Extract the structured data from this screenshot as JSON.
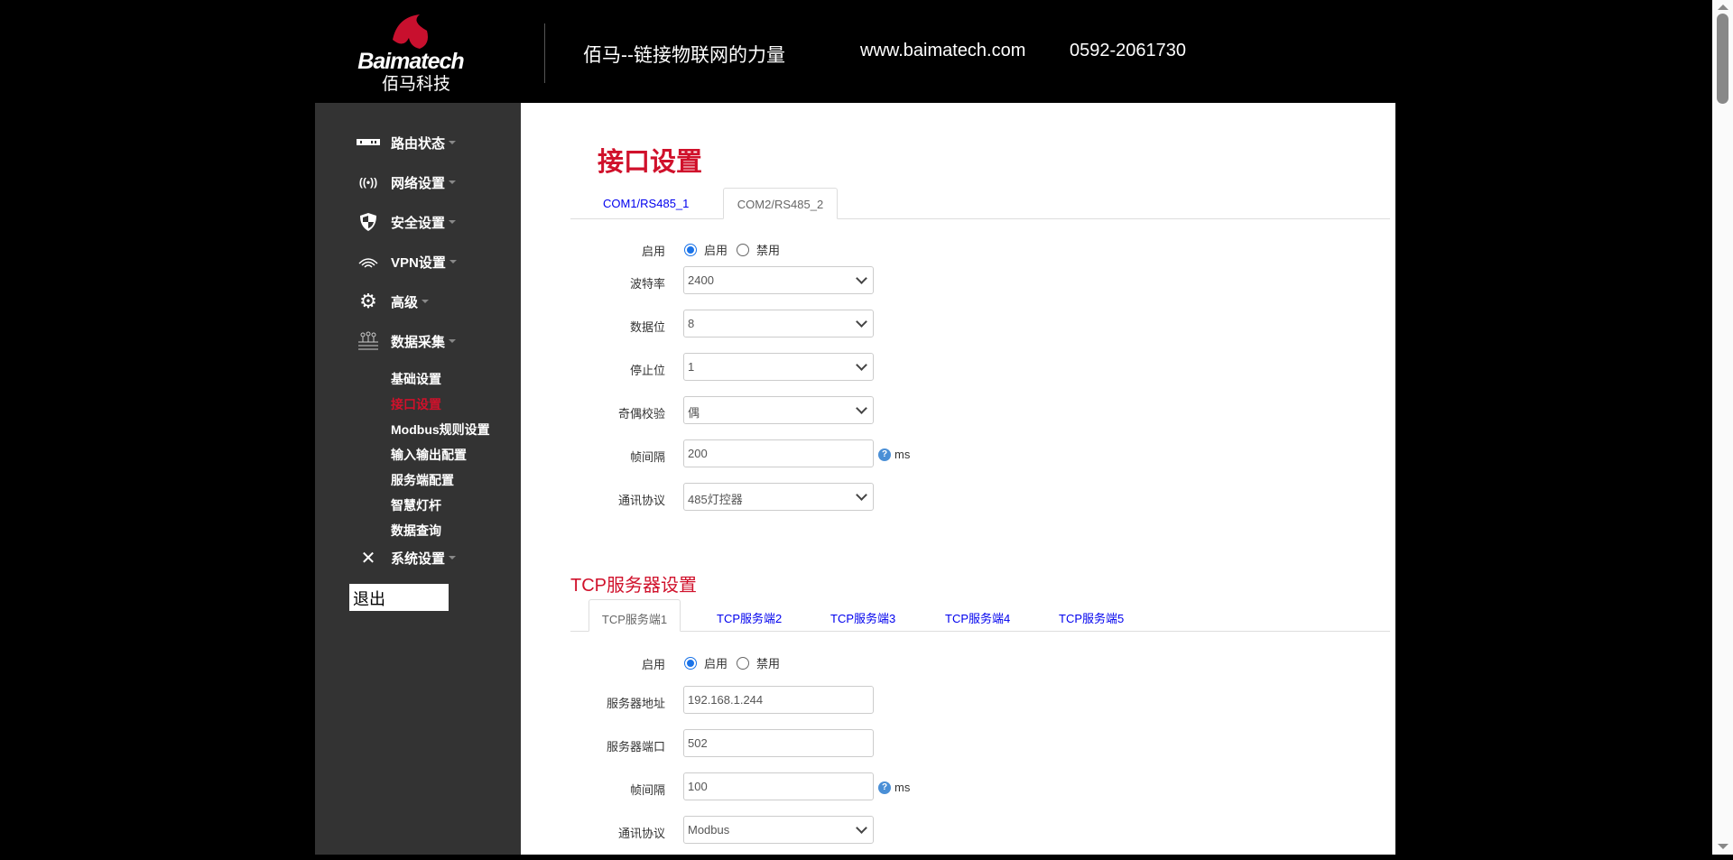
{
  "header": {
    "logo_text": "Baimatech",
    "logo_cn": "佰马科技",
    "slogan": "佰马--链接物联网的力量",
    "website": "www.baimatech.com",
    "phone": "0592-2061730"
  },
  "sidebar": {
    "items": [
      {
        "label": "路由状态",
        "icon": "router-icon"
      },
      {
        "label": "网络设置",
        "icon": "wireless-icon"
      },
      {
        "label": "安全设置",
        "icon": "shield-icon"
      },
      {
        "label": "VPN设置",
        "icon": "vpn-icon"
      },
      {
        "label": "高级",
        "icon": "gear-icon"
      },
      {
        "label": "数据采集",
        "icon": "data-collect-icon"
      }
    ],
    "subitems": [
      "基础设置",
      "接口设置",
      "Modbus规则设置",
      "输入输出配置",
      "服务端配置",
      "智慧灯杆",
      "数据查询"
    ],
    "active_sub": "接口设置",
    "system": "系统设置",
    "logout": "退出"
  },
  "page": {
    "title": "接口设置",
    "tabs": [
      "COM1/RS485_1",
      "COM2/RS485_2"
    ],
    "active_tab": "COM2/RS485_2",
    "form": {
      "enable_label": "启用",
      "enable_on": "启用",
      "enable_off": "禁用",
      "baud_label": "波特率",
      "baud": "2400",
      "databits_label": "数据位",
      "databits": "8",
      "stopbits_label": "停止位",
      "stopbits": "1",
      "parity_label": "奇偶校验",
      "parity": "偶",
      "interval_label": "帧间隔",
      "interval": "200",
      "unit": "ms",
      "protocol_label": "通讯协议",
      "protocol": "485灯控器"
    }
  },
  "tcp": {
    "title": "TCP服务器设置",
    "tabs": [
      "TCP服务端1",
      "TCP服务端2",
      "TCP服务端3",
      "TCP服务端4",
      "TCP服务端5"
    ],
    "active_tab": "TCP服务端1",
    "form": {
      "enable_label": "启用",
      "enable_on": "启用",
      "enable_off": "禁用",
      "addr_label": "服务器地址",
      "addr": "192.168.1.244",
      "port_label": "服务器端口",
      "port": "502",
      "interval_label": "帧间隔",
      "interval": "100",
      "unit": "ms",
      "protocol_label": "通讯协议",
      "protocol": "Modbus"
    }
  },
  "colors": {
    "accent": "#d0112b",
    "link": "#0000ee",
    "sidebar": "#333333"
  }
}
